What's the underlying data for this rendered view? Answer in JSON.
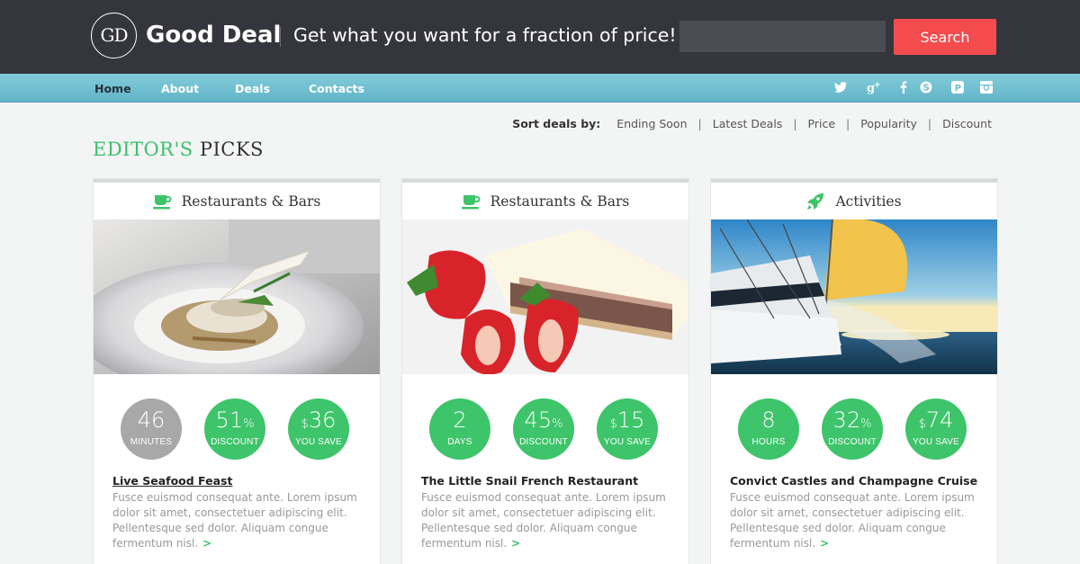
{
  "header": {
    "logo_mark": "GD",
    "brand": "Good Deal",
    "tagline": "Get what you want for a fraction of price!",
    "search_placeholder": "",
    "search_button": "Search"
  },
  "nav": {
    "items": [
      "Home",
      "About",
      "Deals",
      "Contacts"
    ],
    "active": "Home",
    "social": [
      "twitter-icon",
      "google-plus-icon",
      "facebook-icon",
      "skype-icon",
      "pinterest-icon",
      "instagram-icon"
    ]
  },
  "sort": {
    "label": "Sort deals by:",
    "options": [
      "Ending Soon",
      "Latest Deals",
      "Price",
      "Popularity",
      "Discount"
    ],
    "separator": "|"
  },
  "section": {
    "title_accent": "EDITOR'S",
    "title_rest": "PICKS"
  },
  "cards": [
    {
      "category": "Restaurants & Bars",
      "category_icon": "coffee-cup-icon",
      "image": "seafood-dish-photo",
      "stats": [
        {
          "value": "46",
          "suffix": "",
          "prefix": "",
          "unit": "MINUTES"
        },
        {
          "value": "51",
          "suffix": "%",
          "prefix": "",
          "unit": "DISCOUNT"
        },
        {
          "value": "36",
          "suffix": "",
          "prefix": "$",
          "unit": "YOU SAVE"
        }
      ],
      "title": "Live Seafood Feast",
      "description": "Fusce euismod consequat ante. Lorem ipsum dolor sit amet, consectetuer adipiscing elit. Pellentesque sed dolor. Aliquam congue fermentum nisl.",
      "more": ">"
    },
    {
      "category": "Restaurants & Bars",
      "category_icon": "coffee-cup-icon",
      "image": "cheesecake-strawberries-photo",
      "stats": [
        {
          "value": "2",
          "suffix": "",
          "prefix": "",
          "unit": "DAYS"
        },
        {
          "value": "45",
          "suffix": "%",
          "prefix": "",
          "unit": "DISCOUNT"
        },
        {
          "value": "15",
          "suffix": "",
          "prefix": "$",
          "unit": "YOU SAVE"
        }
      ],
      "title": "The Little Snail French Restaurant",
      "description": "Fusce euismod consequat ante. Lorem ipsum dolor sit amet, consectetuer adipiscing elit. Pellentesque sed dolor. Aliquam congue fermentum nisl.",
      "more": ">"
    },
    {
      "category": "Activities",
      "category_icon": "rocket-icon",
      "image": "sailboat-sunset-photo",
      "stats": [
        {
          "value": "8",
          "suffix": "",
          "prefix": "",
          "unit": "HOURS"
        },
        {
          "value": "32",
          "suffix": "%",
          "prefix": "",
          "unit": "DISCOUNT"
        },
        {
          "value": "74",
          "suffix": "",
          "prefix": "$",
          "unit": "YOU SAVE"
        }
      ],
      "title": "Convict Castles and Champagne Cruise",
      "description": "Fusce euismod consequat ante. Lorem ipsum dolor sit amet, consectetuer adipiscing elit. Pellentesque sed dolor. Aliquam congue fermentum nisl.",
      "more": ">"
    }
  ],
  "colors": {
    "header_bg": "#35363d",
    "nav_bg": "#6bbccf",
    "accent_green": "#3ec46a",
    "search_button": "#f44b4f",
    "grey_stat": "#a8a8a8"
  }
}
